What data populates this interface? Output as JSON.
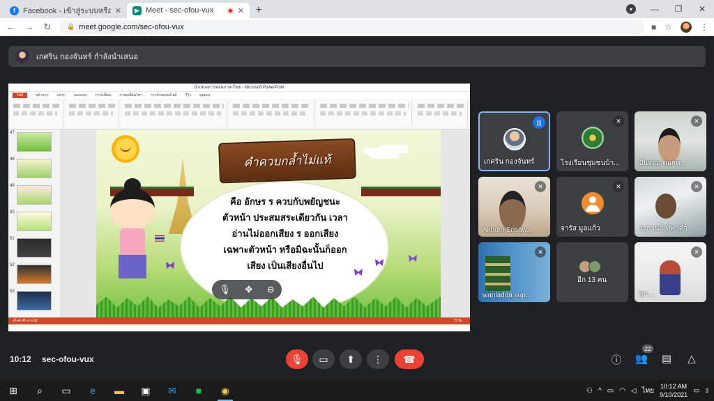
{
  "browser": {
    "tabs": [
      {
        "title": "Facebook - เข้าสู่ระบบหรือสมัครใช้งาน",
        "icon": "facebook-icon",
        "active": false
      },
      {
        "title": "Meet - sec-ofou-vux",
        "icon": "google-meet-icon",
        "active": true
      }
    ],
    "new_tab": "+",
    "url": "meet.google.com/sec-ofou-vux"
  },
  "meet": {
    "presenter_banner": "เกศริน กองจันทร์ กำลังนำเสนอ",
    "meeting_time": "10:12",
    "meeting_code": "sec-ofou-vux",
    "people_count": "22"
  },
  "presentation": {
    "window_title": "นำเสนอการสอนภาษาไทย - Microsoft PowerPoint",
    "ribbon_tabs": [
      "ไฟล์",
      "หน้าแรก",
      "แทรก",
      "ออกแบบ",
      "การเปลี่ยน",
      "ภาพเคลื่อนไหว",
      "การนำเสนอสไลด์",
      "รีวิว",
      "มุมมอง"
    ],
    "slide_numbers": [
      "47",
      "48",
      "49",
      "50",
      "51",
      "52",
      "53"
    ],
    "status_left": "สไลด์ 45 จาก 61",
    "status_right": "75 %",
    "slide": {
      "heading": "คำควบกล้ำไม่แท้",
      "lines": [
        "คือ อักษร ร ควบกับพยัญชนะ",
        "ตัวหน้า ประสมสระเดียวกัน เวลา",
        "อ่านไม่ออกเสียง ร ออกเสียง",
        "เฉพาะตัวหน้า หรือมิฉะนั้นก็ออก",
        "เสียง เป็นเสียงอื่นไป"
      ]
    }
  },
  "participants": [
    {
      "name": "เกศริน กองจันทร์",
      "state": "speaking"
    },
    {
      "name": "โรงเรียนชุมชนบ้า...",
      "state": "muted"
    },
    {
      "name": "ปั้นจอม ดอกต...",
      "state": "muted"
    },
    {
      "name": "Akhom Srisaw...",
      "state": "muted"
    },
    {
      "name": "จารัส มูลแก้ว",
      "state": "muted"
    },
    {
      "name": "วรกานต์ ทิพาคำ",
      "state": "muted"
    },
    {
      "name": "wanladda sup...",
      "state": "muted"
    },
    {
      "name": "อีก 13 คน",
      "state": "group"
    },
    {
      "name": "ศุภ...",
      "state": "muted"
    }
  ],
  "taskbar": {
    "language": "ไทย",
    "time": "10:12 AM",
    "date": "9/10/2021",
    "notifications": "3"
  },
  "colors": {
    "meet_bg": "#202124",
    "tile_bg": "#3c4043",
    "danger": "#ea4335",
    "active_speaker": "#1a73e8",
    "powerpoint": "#d24726"
  }
}
